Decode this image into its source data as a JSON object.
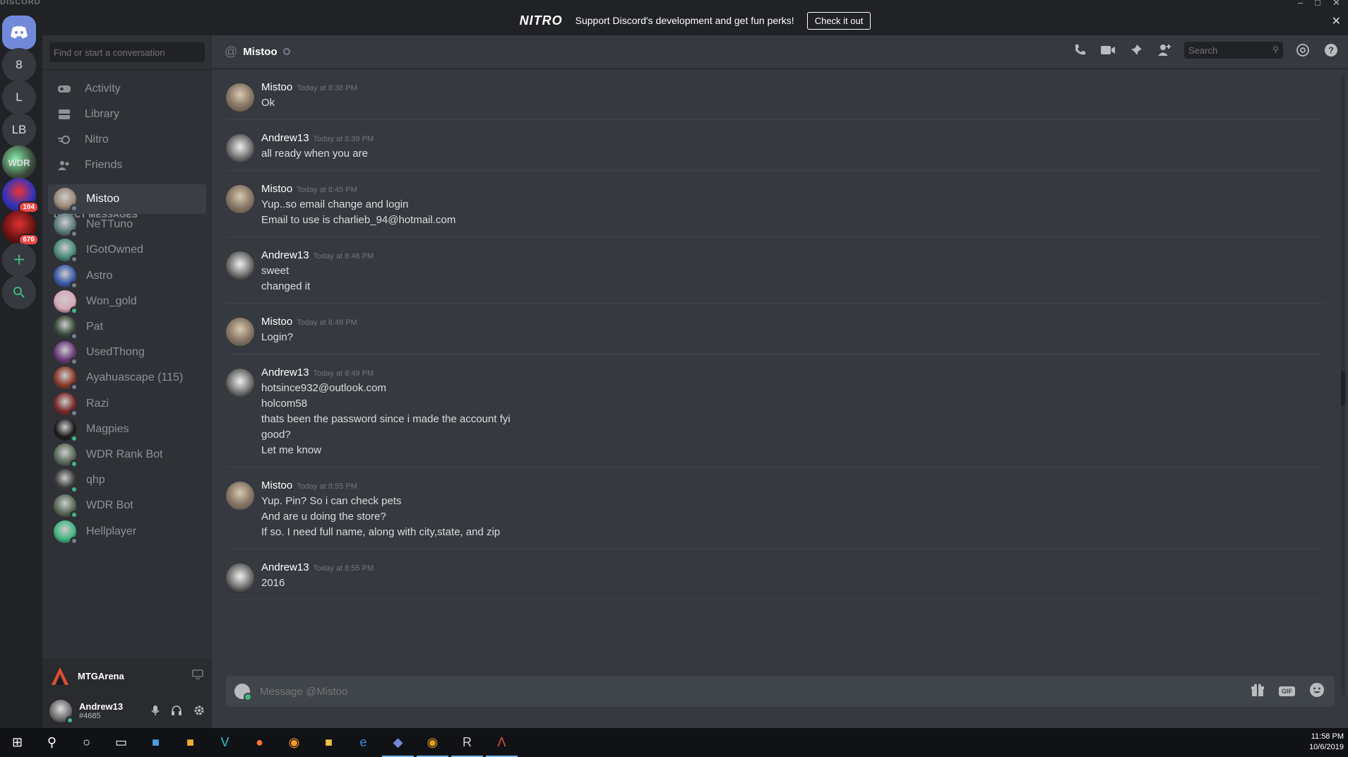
{
  "app": {
    "brand": "DISCORD",
    "window_controls": [
      "–",
      "□",
      "✕"
    ]
  },
  "banner": {
    "logo": "NITRO",
    "text": "Support Discord's development and get fun perks!",
    "button": "Check it out",
    "close": "✕"
  },
  "rail": {
    "guilds": [
      {
        "label": "",
        "kind": "home"
      },
      {
        "label": "8"
      },
      {
        "label": "L"
      },
      {
        "label": "LB"
      },
      {
        "label": "WDR",
        "kind": "image"
      },
      {
        "label": "",
        "kind": "image",
        "badge": "104"
      },
      {
        "label": "",
        "kind": "image",
        "badge": "676"
      }
    ],
    "add": "+",
    "explore": "⚲"
  },
  "sidebar": {
    "search_placeholder": "Find or start a conversation",
    "nav": [
      {
        "label": "Activity",
        "icon": "gamepad-icon"
      },
      {
        "label": "Library",
        "icon": "library-icon"
      },
      {
        "label": "Nitro",
        "icon": "nitro-icon"
      },
      {
        "label": "Friends",
        "icon": "friends-icon"
      }
    ],
    "dm_header": "DIRECT MESSAGES",
    "dms": [
      {
        "name": "Mistoo",
        "status": "offline",
        "color": "#9a8a78",
        "active": true
      },
      {
        "name": "NeTTuno",
        "status": "offline",
        "color": "#5a7a7a"
      },
      {
        "name": "IGotOwned",
        "status": "offline",
        "color": "#4a8a7a"
      },
      {
        "name": "Astro",
        "status": "offline",
        "color": "#3a5aa8"
      },
      {
        "name": "Won_gold",
        "status": "online",
        "color": "#d8a8b8"
      },
      {
        "name": "Pat",
        "status": "offline",
        "color": "#3a4a3a"
      },
      {
        "name": "UsedThong",
        "status": "offline",
        "color": "#6a3a7a"
      },
      {
        "name": "Ayahuascape (115)",
        "status": "offline",
        "color": "#8a3a2a"
      },
      {
        "name": "Razi",
        "status": "offline",
        "color": "#7a2a2a"
      },
      {
        "name": "Magpies",
        "status": "online",
        "color": "#1a1a1a"
      },
      {
        "name": "WDR Rank Bot",
        "status": "online",
        "color": "#5a6a5a"
      },
      {
        "name": "qhp",
        "status": "online",
        "color": "#3a3a3a"
      },
      {
        "name": "WDR Bot",
        "status": "online",
        "color": "#5a6a5a"
      },
      {
        "name": "Hellplayer",
        "status": "offline",
        "color": "#43b581"
      }
    ],
    "activity": {
      "game": "MTGArena"
    },
    "user": {
      "name": "Andrew13",
      "tag": "#4685"
    }
  },
  "chat": {
    "channel_name": "Mistoo",
    "search_placeholder": "Search",
    "composer_placeholder": "Message @Mistoo",
    "gif_label": "GIF",
    "messages": [
      {
        "author": "Mistoo",
        "time": "Today at 8:38 PM",
        "lines": [
          "Ok"
        ]
      },
      {
        "author": "Andrew13",
        "time": "Today at 8:39 PM",
        "lines": [
          "all ready when you are"
        ]
      },
      {
        "author": "Mistoo",
        "time": "Today at 8:45 PM",
        "lines": [
          "Yup..so email change and login",
          "Email to use is charlieb_94@hotmail.com"
        ]
      },
      {
        "author": "Andrew13",
        "time": "Today at 8:46 PM",
        "lines": [
          "sweet",
          "changed it"
        ]
      },
      {
        "author": "Mistoo",
        "time": "Today at 8:49 PM",
        "lines": [
          "Login?"
        ]
      },
      {
        "author": "Andrew13",
        "time": "Today at 8:49 PM",
        "lines": [
          "hotsince932@outlook.com",
          "holcom58",
          "thats been the password since i made the account fyi",
          "good?",
          "Let me know"
        ]
      },
      {
        "author": "Mistoo",
        "time": "Today at 8:55 PM",
        "lines": [
          "Yup. Pin? So i can check pets",
          "And are u doing the store?",
          "If so. I need full name, along with city,state, and zip"
        ]
      },
      {
        "author": "Andrew13",
        "time": "Today at 8:55 PM",
        "lines": [
          "2016"
        ]
      }
    ]
  },
  "taskbar": {
    "time": "11:58 PM",
    "date": "10/6/2019",
    "apps": [
      {
        "name": "start",
        "glyph": "⊞",
        "color": "#ffffff"
      },
      {
        "name": "search",
        "glyph": "⚲",
        "color": "#ffffff"
      },
      {
        "name": "cortana",
        "glyph": "○",
        "color": "#ffffff"
      },
      {
        "name": "task-view",
        "glyph": "▭",
        "color": "#ffffff"
      },
      {
        "name": "store",
        "glyph": "■",
        "color": "#4aa0e0"
      },
      {
        "name": "sticky",
        "glyph": "■",
        "color": "#f0b030"
      },
      {
        "name": "app-v",
        "glyph": "V",
        "color": "#30c0d0"
      },
      {
        "name": "firefox",
        "glyph": "●",
        "color": "#ff7a2a"
      },
      {
        "name": "app-orange",
        "glyph": "◉",
        "color": "#ff9a2a"
      },
      {
        "name": "explorer",
        "glyph": "■",
        "color": "#f0c040"
      },
      {
        "name": "edge",
        "glyph": "e",
        "color": "#3a8ae0"
      },
      {
        "name": "discord",
        "glyph": "◆",
        "color": "#7289da",
        "active": true
      },
      {
        "name": "chrome",
        "glyph": "◉",
        "color": "#e0a020",
        "active": true
      },
      {
        "name": "runelite",
        "glyph": "R",
        "color": "#d0d0d0",
        "active": true
      },
      {
        "name": "mtga",
        "glyph": "Λ",
        "color": "#e05030",
        "active": true
      }
    ]
  }
}
